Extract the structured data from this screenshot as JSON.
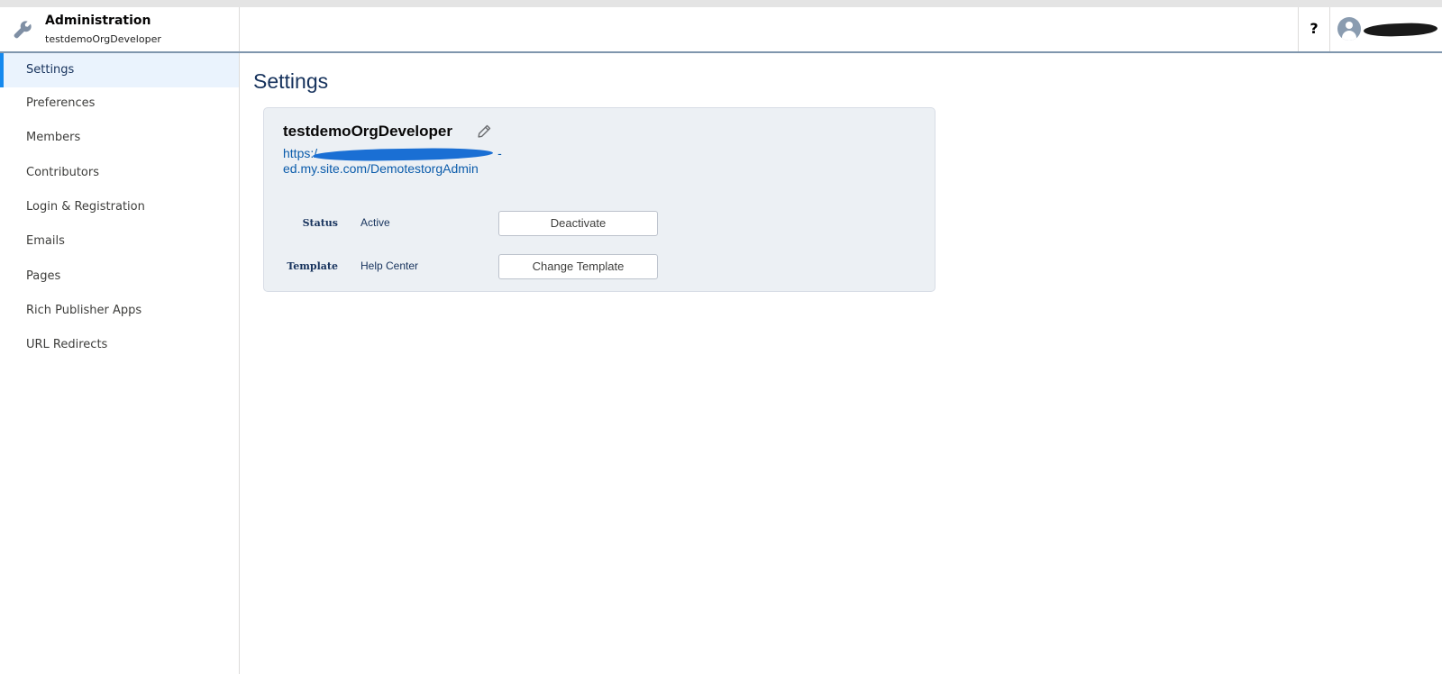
{
  "header": {
    "app_title": "Administration",
    "org_name": "testdemoOrgDeveloper",
    "help_label": "?",
    "user_name": "",
    "wrench_icon": "wrench-icon",
    "avatar_icon": "user-avatar-icon"
  },
  "sidebar": {
    "items": [
      {
        "label": "Settings",
        "active": true
      },
      {
        "label": "Preferences"
      },
      {
        "label": "Members"
      },
      {
        "label": "Contributors"
      },
      {
        "label": "Login & Registration"
      },
      {
        "label": "Emails"
      },
      {
        "label": "Pages"
      },
      {
        "label": "Rich Publisher Apps"
      },
      {
        "label": "URL Redirects"
      }
    ]
  },
  "main": {
    "page_title": "Settings",
    "site": {
      "name": "testdemoOrgDeveloper",
      "url_line1": "https:/",
      "url_line2_suffix": "-",
      "url_line2": "ed.my.site.com/DemotestorgAdmin",
      "edit_icon": "pencil-icon"
    },
    "status": {
      "label": "Status",
      "value": "Active",
      "button": "Deactivate"
    },
    "template": {
      "label": "Template",
      "value": "Help Center",
      "button": "Change Template"
    }
  },
  "colors": {
    "accent": "#1589ee",
    "active_bg": "#eaf3fd",
    "card_bg": "#ecf0f4",
    "link": "#0b5cab"
  }
}
